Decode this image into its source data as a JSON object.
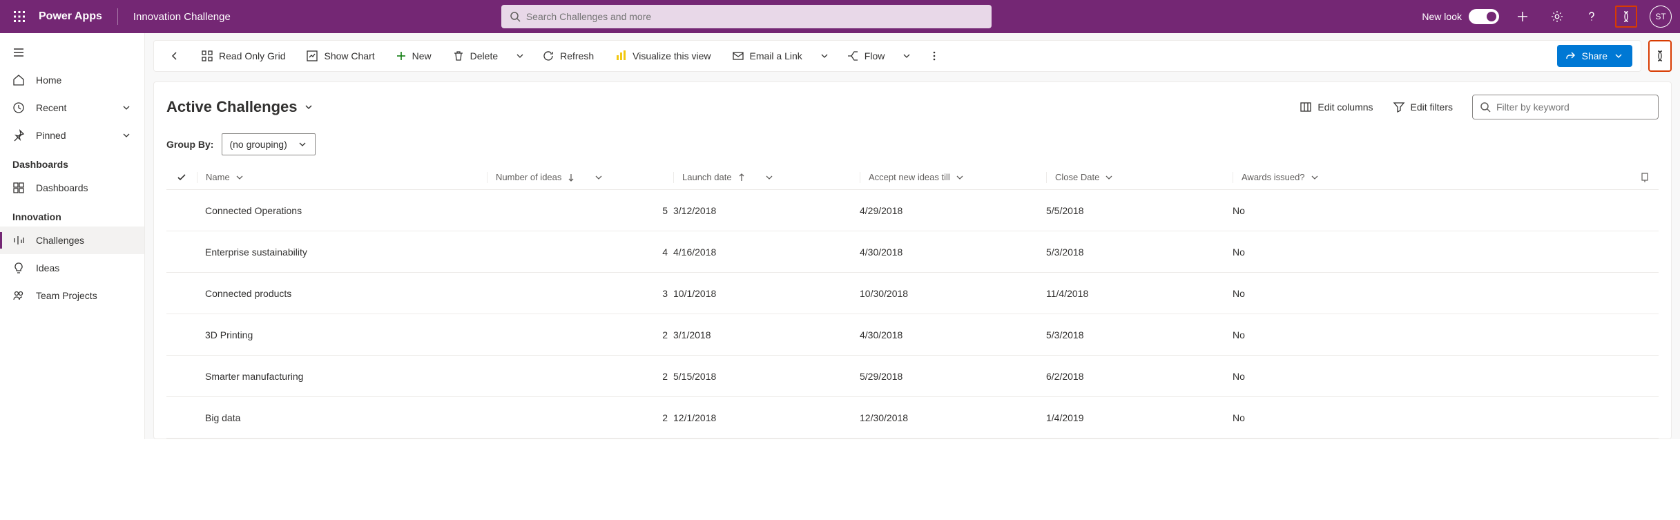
{
  "header": {
    "app_name": "Power Apps",
    "app_title": "Innovation Challenge",
    "search_placeholder": "Search Challenges and more",
    "new_look_label": "New look",
    "avatar_initials": "ST"
  },
  "sidebar": {
    "home": "Home",
    "recent": "Recent",
    "pinned": "Pinned",
    "heading_dashboards": "Dashboards",
    "dashboards_item": "Dashboards",
    "heading_innovation": "Innovation",
    "challenges": "Challenges",
    "ideas": "Ideas",
    "team_projects": "Team Projects"
  },
  "commands": {
    "read_only_grid": "Read Only Grid",
    "show_chart": "Show Chart",
    "new": "New",
    "delete": "Delete",
    "refresh": "Refresh",
    "visualize": "Visualize this view",
    "email_link": "Email a Link",
    "flow": "Flow",
    "share": "Share"
  },
  "view": {
    "title": "Active Challenges",
    "edit_columns": "Edit columns",
    "edit_filters": "Edit filters",
    "filter_placeholder": "Filter by keyword",
    "groupby_label": "Group By:",
    "groupby_value": "(no grouping)"
  },
  "columns": {
    "name": "Name",
    "ideas": "Number of ideas",
    "launch": "Launch date",
    "accept": "Accept new ideas till",
    "close": "Close Date",
    "awards": "Awards issued?"
  },
  "rows": [
    {
      "name": "Connected Operations",
      "ideas": "5",
      "launch": "3/12/2018",
      "accept": "4/29/2018",
      "close": "5/5/2018",
      "awards": "No"
    },
    {
      "name": "Enterprise sustainability",
      "ideas": "4",
      "launch": "4/16/2018",
      "accept": "4/30/2018",
      "close": "5/3/2018",
      "awards": "No"
    },
    {
      "name": "Connected products",
      "ideas": "3",
      "launch": "10/1/2018",
      "accept": "10/30/2018",
      "close": "11/4/2018",
      "awards": "No"
    },
    {
      "name": "3D Printing",
      "ideas": "2",
      "launch": "3/1/2018",
      "accept": "4/30/2018",
      "close": "5/3/2018",
      "awards": "No"
    },
    {
      "name": "Smarter manufacturing",
      "ideas": "2",
      "launch": "5/15/2018",
      "accept": "5/29/2018",
      "close": "6/2/2018",
      "awards": "No"
    },
    {
      "name": "Big data",
      "ideas": "2",
      "launch": "12/1/2018",
      "accept": "12/30/2018",
      "close": "1/4/2019",
      "awards": "No"
    }
  ]
}
